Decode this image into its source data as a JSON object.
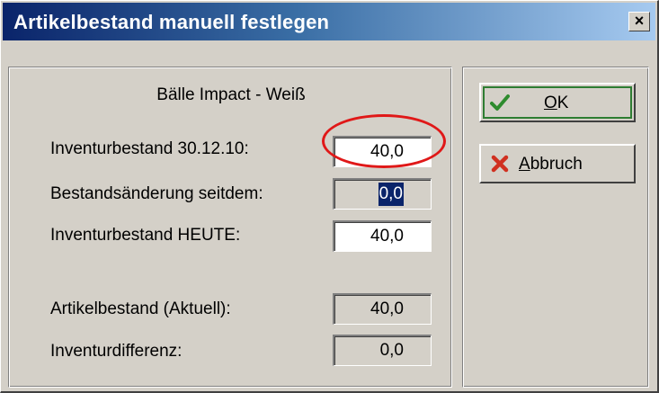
{
  "window": {
    "title": "Artikelbestand manuell festlegen",
    "close_label": "×"
  },
  "form": {
    "heading": "Bälle Impact - Weiß",
    "rows": [
      {
        "label": "Inventurbestand 30.12.10:",
        "value": "40,0",
        "state": "editable"
      },
      {
        "label": "Bestandsänderung seitdem:",
        "value": "0,0",
        "state": "selected-readonly"
      },
      {
        "label": "Inventurbestand HEUTE:",
        "value": "40,0",
        "state": "editable"
      },
      {
        "label": "Artikelbestand (Aktuell):",
        "value": "40,0",
        "state": "readonly"
      },
      {
        "label": "Inventurdifferenz:",
        "value": "0,0",
        "state": "readonly"
      }
    ]
  },
  "buttons": {
    "ok": {
      "mnemonic": "O",
      "rest": "K",
      "icon": "checkmark-icon"
    },
    "cancel": {
      "mnemonic": "A",
      "rest": "bbruch",
      "icon": "cross-icon"
    }
  },
  "colors": {
    "title_gradient_start": "#0a246a",
    "title_gradient_end": "#a6caf0",
    "highlight_ring": "#e01818",
    "dialog_face": "#d4d0c8"
  }
}
